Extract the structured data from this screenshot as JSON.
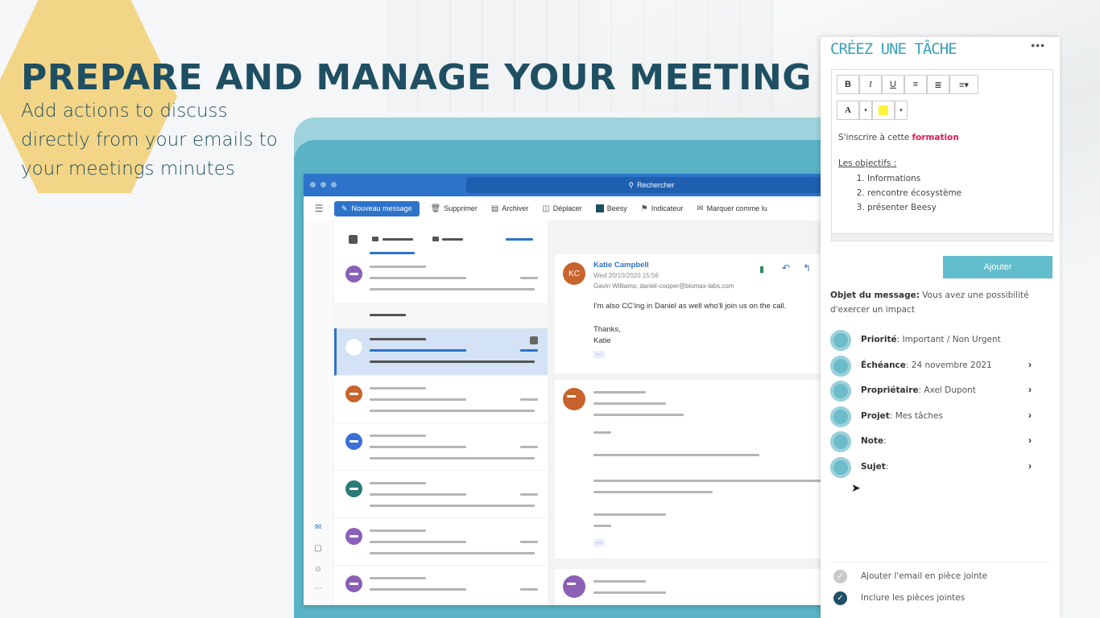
{
  "slide": {
    "headline": "PREPARE AND MANAGE YOUR MEETING",
    "subtitle": "Add actions to discuss directly from your emails to your meetings minutes"
  },
  "outlook": {
    "search": "Rechercher",
    "toolbar": {
      "new_message": "Nouveau message",
      "delete": "Supprimer",
      "archive": "Archiver",
      "move": "Déplacer",
      "beesy": "Beesy",
      "flag": "Indicateur",
      "mark_read": "Marquer comme lu"
    },
    "email": {
      "avatar_initials": "KC",
      "sender": "Katie Campbell",
      "date": "Wed 20/10/2020 15:56",
      "recipients": "Gavin Williams; daniel-cooper@biomax-labs.com",
      "body_line": "I'm also CC'ing in Daniel as well who'll join us on the call.",
      "closing": "Thanks,",
      "signature": "Katie",
      "more": "···"
    },
    "more2": "···"
  },
  "task_panel": {
    "title": "CRÉEZ UNE TÂCHE",
    "more": "•••",
    "editor": {
      "bold": "B",
      "italic": "I",
      "underline": "U",
      "font_color": "A",
      "line1_prefix": "S'inscrire à cette ",
      "line1_highlight": "formation",
      "objectives_title": "Les objectifs :",
      "objectives": [
        "Informations",
        "rencontre écosystème",
        "présenter Beesy"
      ]
    },
    "add_button": "Ajouter",
    "subject_label": "Objet du message:",
    "subject_value": " Vous avez une possibilité d'exercer un impact",
    "properties": [
      {
        "label": "Priorité",
        "value": ": Important / Non Urgent",
        "chevron": ""
      },
      {
        "label": "Échéance",
        "value": ": 24 novembre 2021",
        "chevron": "›"
      },
      {
        "label": "Propriétaire",
        "value": ": Axel Dupont",
        "chevron": "›"
      },
      {
        "label": "Projet",
        "value": ": Mes tâches",
        "chevron": "›"
      },
      {
        "label": "Note",
        "value": ":",
        "chevron": "›"
      },
      {
        "label": "Sujet",
        "value": ":",
        "chevron": "›"
      }
    ],
    "attach_email": "Ajouter l'email en pièce jointe",
    "include_attachments": "Inclure les pièces jointes"
  },
  "colors": {
    "headline": "#1f4f63",
    "outlook_blue": "#2d73c9",
    "teal": "#5ab4c6",
    "panel_accent": "#3aa0b8"
  }
}
